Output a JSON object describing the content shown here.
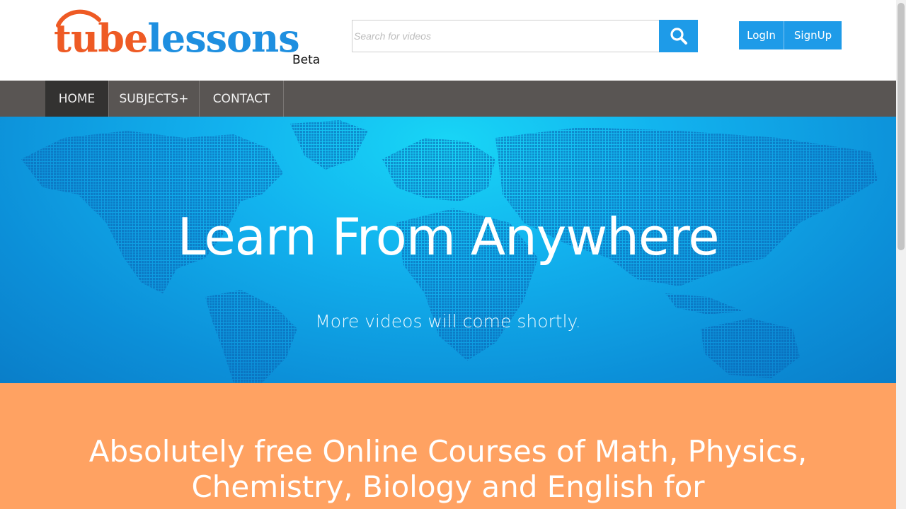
{
  "brand": {
    "logo_part1": "tube",
    "logo_part2": "lessons",
    "beta_label": "Beta",
    "colors": {
      "orange": "#ee5a24",
      "blue": "#1e8fe0"
    }
  },
  "search": {
    "placeholder": "Search for videos",
    "value": "",
    "button_icon": "search-icon",
    "button_color": "#1e9be8"
  },
  "auth": {
    "login_label": "LogIn",
    "signup_label": "SignUp",
    "color": "#1e9be8"
  },
  "nav": {
    "items": [
      {
        "label": "HOME",
        "active": true
      },
      {
        "label": "SUBJECTS+",
        "active": false
      },
      {
        "label": "CONTACT",
        "active": false
      }
    ],
    "background": "#595553",
    "active_background": "#333231"
  },
  "hero": {
    "title": "Learn From Anywhere",
    "subtitle": "More videos will come shortly.",
    "background_image": "world-map"
  },
  "promo": {
    "text": "Absolutely free Online Courses of Math, Physics, Chemistry, Biology and English for",
    "background": "#ffa262"
  }
}
